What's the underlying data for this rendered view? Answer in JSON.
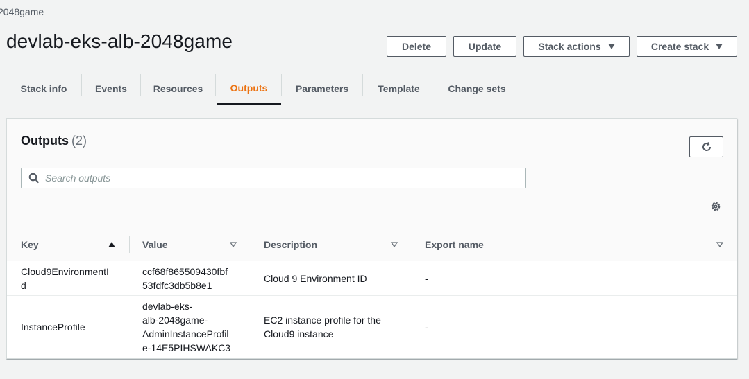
{
  "breadcrumb": "2048game",
  "page_title": "devlab-eks-alb-2048game",
  "actions": {
    "delete": "Delete",
    "update": "Update",
    "stack_actions": "Stack actions",
    "create_stack": "Create stack"
  },
  "tabs": [
    {
      "label": "Stack info"
    },
    {
      "label": "Events"
    },
    {
      "label": "Resources"
    },
    {
      "label": "Outputs",
      "active": true
    },
    {
      "label": "Parameters"
    },
    {
      "label": "Template"
    },
    {
      "label": "Change sets"
    }
  ],
  "outputs": {
    "title": "Outputs",
    "count": "(2)",
    "search_placeholder": "Search outputs",
    "columns": {
      "key": "Key",
      "value": "Value",
      "description": "Description",
      "export_name": "Export name"
    },
    "rows": [
      {
        "key": "Cloud9EnvironmentId",
        "key_lines": [
          "Cloud9EnvironmentI",
          "d"
        ],
        "value_lines": [
          "ccf68f865509430fbf",
          "53fdfc3db5b8e1"
        ],
        "description_lines": [
          "Cloud 9 Environment ID"
        ],
        "export_name": "-"
      },
      {
        "key": "InstanceProfile",
        "key_lines": [
          "InstanceProfile"
        ],
        "value_lines": [
          "devlab-eks-",
          "alb-2048game-",
          "AdminInstanceProfil",
          "e-14E5PIHSWAKC3"
        ],
        "description_lines": [
          "EC2 instance profile for the",
          "Cloud9 instance"
        ],
        "export_name": "-"
      }
    ]
  },
  "icons": {
    "refresh": "refresh-icon",
    "search": "search-icon",
    "settings": "gear-icon",
    "sort_asc": "sort-ascending-icon",
    "sort": "sort-icon",
    "dropdown": "caret-down-icon"
  },
  "colors": {
    "active_tab": "#ec7211",
    "background": "#f2f3f3",
    "text": "#16191f",
    "secondary_text": "#545b64"
  }
}
